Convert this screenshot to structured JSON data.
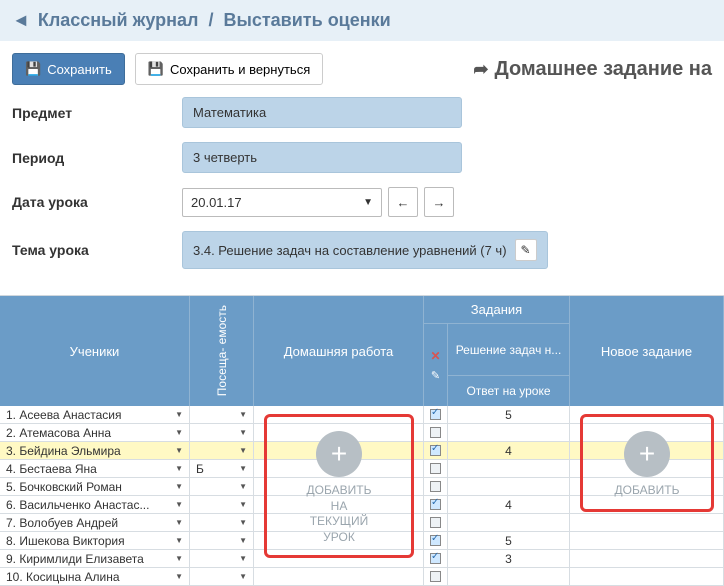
{
  "breadcrumb": {
    "back_icon": "◄",
    "part1": "Классный журнал",
    "sep": "/",
    "part2": "Выставить оценки"
  },
  "toolbar": {
    "save_label": "Сохранить",
    "save_return_label": "Сохранить и вернуться",
    "hw_link": "Домашнее задание на"
  },
  "form": {
    "subject_label": "Предмет",
    "subject_value": "Математика",
    "period_label": "Период",
    "period_value": "3 четверть",
    "date_label": "Дата урока",
    "date_value": "20.01.17",
    "topic_label": "Тема урока",
    "topic_value": "3.4. Решение задач на составление уравнений (7 ч)"
  },
  "grid": {
    "students_header": "Ученики",
    "attend_header": "Посеща-\nемость",
    "hw_header": "Домашняя работа",
    "tasks_header": "Задания",
    "task_name": "Решение задач н...",
    "answer_label": "Ответ на уроке",
    "new_header": "Новое задание",
    "add_hw": "ДОБАВИТЬ\nНА\nТЕКУЩИЙ\nУРОК",
    "add_new": "ДОБАВИТЬ",
    "rows": [
      {
        "n": "1",
        "name": "Асеева Анастасия",
        "att": "",
        "chk": true,
        "grade": "5",
        "hl": false
      },
      {
        "n": "2",
        "name": "Атемасова Анна",
        "att": "",
        "chk": false,
        "grade": "",
        "hl": false
      },
      {
        "n": "3",
        "name": "Бейдина Эльмира",
        "att": "",
        "chk": true,
        "grade": "4",
        "hl": true
      },
      {
        "n": "4",
        "name": "Бестаева Яна",
        "att": "Б",
        "chk": false,
        "grade": "",
        "hl": false
      },
      {
        "n": "5",
        "name": "Бочковский Роман",
        "att": "",
        "chk": false,
        "grade": "",
        "hl": false
      },
      {
        "n": "6",
        "name": "Васильченко Анастас...",
        "att": "",
        "chk": true,
        "grade": "4",
        "hl": false
      },
      {
        "n": "7",
        "name": "Волобуев Андрей",
        "att": "",
        "chk": false,
        "grade": "",
        "hl": false
      },
      {
        "n": "8",
        "name": "Ишекова Виктория",
        "att": "",
        "chk": true,
        "grade": "5",
        "hl": false
      },
      {
        "n": "9",
        "name": "Киримлиди Елизавета",
        "att": "",
        "chk": true,
        "grade": "3",
        "hl": false
      },
      {
        "n": "10",
        "name": "Косицына Алина",
        "att": "",
        "chk": false,
        "grade": "",
        "hl": false
      }
    ]
  }
}
